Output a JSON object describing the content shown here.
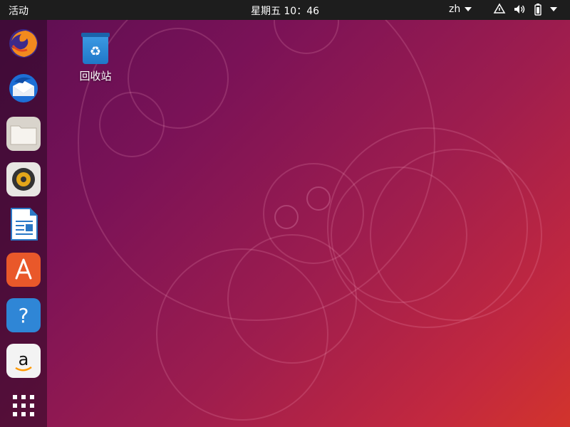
{
  "topbar": {
    "activities": "活动",
    "clock": "星期五 10：46",
    "language": "zh",
    "network_icon": "network-icon",
    "volume_icon": "volume-icon",
    "battery_icon": "battery-icon"
  },
  "dock": {
    "items": [
      {
        "name": "Firefox",
        "icon": "firefox-icon"
      },
      {
        "name": "Thunderbird",
        "icon": "thunderbird-icon"
      },
      {
        "name": "Files",
        "icon": "files-icon"
      },
      {
        "name": "Rhythmbox",
        "icon": "rhythmbox-icon"
      },
      {
        "name": "LibreOffice Writer",
        "icon": "writer-icon"
      },
      {
        "name": "Ubuntu Software",
        "icon": "software-icon"
      },
      {
        "name": "Help",
        "icon": "help-icon"
      },
      {
        "name": "Amazon",
        "icon": "amazon-icon"
      },
      {
        "name": "Show Applications",
        "icon": "apps-grid-icon"
      }
    ]
  },
  "desktop": {
    "trash_label": "回收站"
  },
  "colors": {
    "topbar": "#1d1d1d",
    "bg_start": "#5a0e52",
    "bg_end": "#d2342c"
  }
}
